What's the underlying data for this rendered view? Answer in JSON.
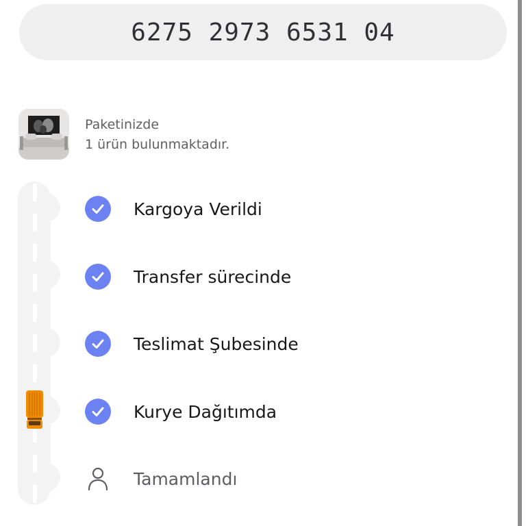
{
  "tracking": {
    "number": "6275 2973 6531 04"
  },
  "package": {
    "line1": "Paketinizde",
    "line2": "1 ürün bulunmaktadır."
  },
  "steps": [
    {
      "label": "Kargoya Verildi",
      "status": "done",
      "icon": "check-circle-icon"
    },
    {
      "label": "Transfer sürecinde",
      "status": "done",
      "icon": "check-circle-icon"
    },
    {
      "label": "Teslimat Şubesinde",
      "status": "done",
      "icon": "check-circle-icon"
    },
    {
      "label": "Kurye Dağıtımda",
      "status": "done",
      "icon": "check-circle-icon"
    },
    {
      "label": "Tamamlandı",
      "status": "pending",
      "icon": "person-icon"
    }
  ],
  "colors": {
    "accent": "#6d82f2",
    "truck": "#f08a00",
    "pill_bg": "#efeff0"
  }
}
